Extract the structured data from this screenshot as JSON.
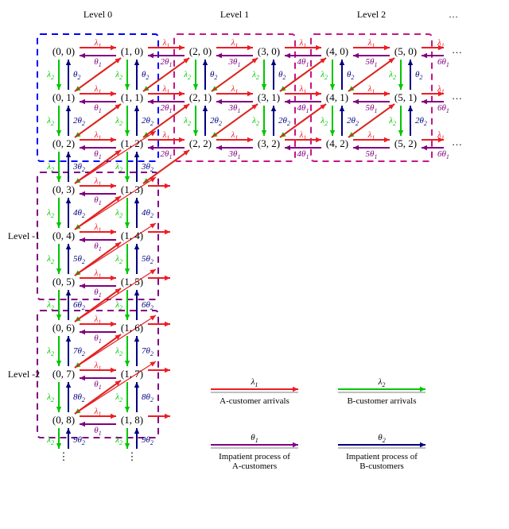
{
  "levels": {
    "h_title_0": "Level 0",
    "h_title_1": "Level 1",
    "h_title_2": "Level 2",
    "h_dots": "…",
    "v_title_m1": "Level -1",
    "v_title_m2": "Level -2"
  },
  "symbols": {
    "lambda1": "λ",
    "lambda1_sub": "1",
    "lambda2": "λ",
    "lambda2_sub": "2",
    "theta1": "θ",
    "theta1_sub": "1",
    "theta2": "θ",
    "theta2_sub": "2"
  },
  "legend": {
    "a_arrivals": {
      "sym": "λ",
      "sub": "1",
      "caption": "A-customer arrivals"
    },
    "b_arrivals": {
      "sym": "λ",
      "sub": "2",
      "caption": "B-customer arrivals"
    },
    "a_impatient": {
      "sym": "θ",
      "sub": "1",
      "caption": "Impatient process of\nA-customers"
    },
    "b_impatient": {
      "sym": "θ",
      "sub": "2",
      "caption": "Impatient process of\nB-customers"
    }
  },
  "colors": {
    "red": "#ed1c24",
    "green": "#00c600",
    "purple": "#800080",
    "navy": "#000080",
    "blue_dash": "#0000ff",
    "magenta_dash": "#c71585",
    "purple_dash": "#800080"
  },
  "chart_data": {
    "type": "diagram",
    "description": "State-transition diagram of a bivariate Markov chain on states (m,n), m,n≥0, with level groupings.",
    "state_label": "(m,n)",
    "states_drawn": [
      [
        0,
        0
      ],
      [
        1,
        0
      ],
      [
        2,
        0
      ],
      [
        3,
        0
      ],
      [
        4,
        0
      ],
      [
        5,
        0
      ],
      [
        0,
        1
      ],
      [
        1,
        1
      ],
      [
        2,
        1
      ],
      [
        3,
        1
      ],
      [
        4,
        1
      ],
      [
        5,
        1
      ],
      [
        0,
        2
      ],
      [
        1,
        2
      ],
      [
        2,
        2
      ],
      [
        3,
        2
      ],
      [
        4,
        2
      ],
      [
        5,
        2
      ],
      [
        0,
        3
      ],
      [
        1,
        3
      ],
      [
        0,
        4
      ],
      [
        1,
        4
      ],
      [
        0,
        5
      ],
      [
        1,
        5
      ],
      [
        0,
        6
      ],
      [
        1,
        6
      ],
      [
        0,
        7
      ],
      [
        1,
        7
      ],
      [
        0,
        8
      ],
      [
        1,
        8
      ]
    ],
    "transitions": [
      {
        "name": "A-arrival",
        "direction": "(m,n)→(m+1,n)",
        "rate": "λ1",
        "color": "red"
      },
      {
        "name": "B-arrival",
        "direction": "(m,n)→(m,n+1)",
        "rate": "λ2",
        "color": "green"
      },
      {
        "name": "A-impatient",
        "direction": "(m,n)→(m-1,n)",
        "rate": "m·θ1",
        "color": "purple"
      },
      {
        "name": "B-impatient",
        "direction": "(m,n)→(m,n-1)",
        "rate": "n·θ2",
        "color": "navy"
      },
      {
        "name": "A-arrival-diag",
        "direction": "(m,n)→(m+1,n-1) for n≥1",
        "rate": "λ1",
        "color": "red"
      },
      {
        "name": "B-arrival-diag",
        "direction": "(m,n)→(m-1,n+1) for m≥1",
        "rate": "λ2",
        "color": "green"
      }
    ],
    "edge_rate_labels_shown": {
      "theta1_along_m": [
        "θ1",
        "2θ1",
        "3θ1",
        "4θ1",
        "5θ1",
        "6θ1"
      ],
      "theta2_along_n": [
        "θ2",
        "2θ2",
        "3θ2",
        "4θ2",
        "5θ2",
        "6θ2",
        "7θ2",
        "8θ2",
        "9θ2"
      ]
    },
    "level_groups": {
      "Level 0": {
        "m": [
          0,
          1
        ],
        "n": [
          0,
          2
        ],
        "border": "blue-dash"
      },
      "Level 1": {
        "m": [
          2,
          3
        ],
        "n": [
          0,
          2
        ],
        "border": "magenta-dash"
      },
      "Level 2": {
        "m": [
          4,
          5
        ],
        "n": [
          0,
          2
        ],
        "border": "magenta-dash"
      },
      "Level -1": {
        "m": [
          0,
          1
        ],
        "n": [
          3,
          5
        ],
        "border": "purple-dash"
      },
      "Level -2": {
        "m": [
          0,
          1
        ],
        "n": [
          6,
          8
        ],
        "border": "purple-dash"
      }
    }
  }
}
